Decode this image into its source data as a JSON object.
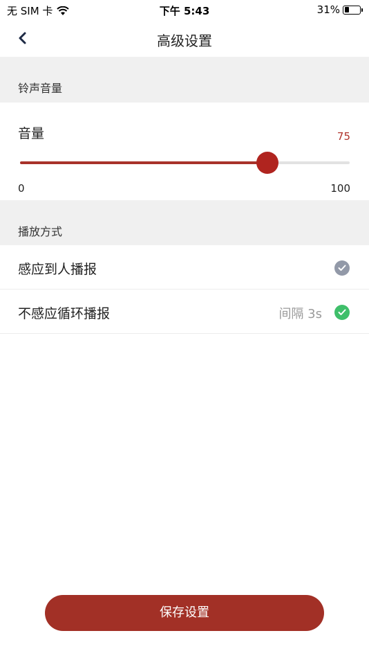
{
  "status_bar": {
    "carrier": "无 SIM 卡",
    "time": "下午 5:43",
    "battery_percent": "31%",
    "battery_level": 0.31
  },
  "nav": {
    "title": "高级设置",
    "back_icon": "chevron-left-icon"
  },
  "ringtone_section": {
    "header": "铃声音量",
    "volume_label": "音量",
    "volume_value": "75",
    "value": 75,
    "min_label": "0",
    "max_label": "100",
    "min": 0,
    "max": 100,
    "accent_color": "#a8322a"
  },
  "playback_section": {
    "header": "播放方式",
    "options": [
      {
        "label": "感应到人播报",
        "interval": "",
        "selected": false,
        "check_color": "#9299a8"
      },
      {
        "label": "不感应循环播报",
        "interval": "间隔 3s",
        "selected": true,
        "check_color": "#3fbf6a"
      }
    ]
  },
  "save_button_label": "保存设置",
  "button_color": "#a23026"
}
